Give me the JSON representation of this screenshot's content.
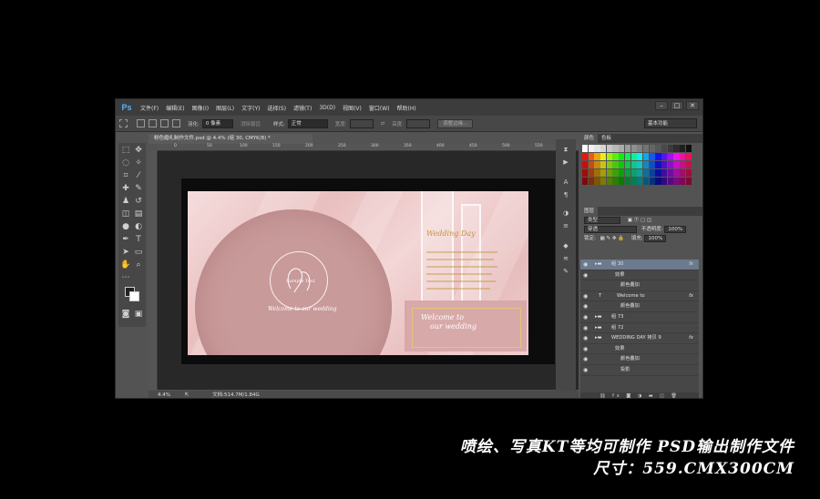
{
  "app": {
    "logo": "Ps"
  },
  "menu": [
    "文件(F)",
    "编辑(E)",
    "图像(I)",
    "图层(L)",
    "文字(Y)",
    "选择(S)",
    "滤镜(T)",
    "3D(D)",
    "视图(V)",
    "窗口(W)",
    "帮助(H)"
  ],
  "window_controls": [
    "–",
    "□",
    "✕"
  ],
  "options": {
    "feather_label": "羽化:",
    "feather_value": "0 像素",
    "antialias": "消除锯齿",
    "style_label": "样式:",
    "style_value": "正常",
    "width_label": "宽度:",
    "height_label": "高度:",
    "refine_edge": "调整边缘...",
    "workspace": "基本功能"
  },
  "document": {
    "tab_title": "粉色婚礼制作文件.psd @ 4.4% (组 30, CMYK/8) *",
    "ruler_ticks": [
      "0",
      "50",
      "100",
      "150",
      "200",
      "250",
      "300",
      "350",
      "400",
      "450",
      "500",
      "550"
    ],
    "zoom": "4.4%",
    "doc_size": "文档:514.7M/1.84G"
  },
  "artwork": {
    "logo_text": "Sample Text",
    "circle_welcome": "Welcome to our wedding",
    "wedding_day": "Wedding Day",
    "box_welcome_line1": "Welcome to",
    "box_welcome_line2": "our wedding"
  },
  "panels": {
    "color_tab": "颜色",
    "swatches_tab": "色板",
    "layers_tab": "图层",
    "kind_label": "类型",
    "blend_mode": "穿透",
    "opacity_label": "不透明度:",
    "opacity_value": "100%",
    "lock_label": "锁定:",
    "fill_label": "填充:",
    "fill_value": "100%"
  },
  "layers": [
    {
      "name": "组 30",
      "type": "group",
      "fx": "fx",
      "selected": true
    },
    {
      "name": "效果",
      "type": "effects"
    },
    {
      "name": "颜色叠加",
      "type": "effect"
    },
    {
      "name": "Welcome to",
      "type": "text",
      "fx": "fx"
    },
    {
      "name": "颜色叠加",
      "type": "effect"
    },
    {
      "name": "组 73",
      "type": "group"
    },
    {
      "name": "组 72",
      "type": "group"
    },
    {
      "name": "WEDDING DAY 拷贝 9",
      "type": "group",
      "fx": "fx"
    },
    {
      "name": "效果",
      "type": "effects"
    },
    {
      "name": "颜色叠加",
      "type": "effect"
    },
    {
      "name": "投影",
      "type": "effect"
    }
  ],
  "caption": {
    "line1": "喷绘、写真KT等均可制作  PSD输出制作文件",
    "line2": "尺寸：559.CMX300CM"
  }
}
